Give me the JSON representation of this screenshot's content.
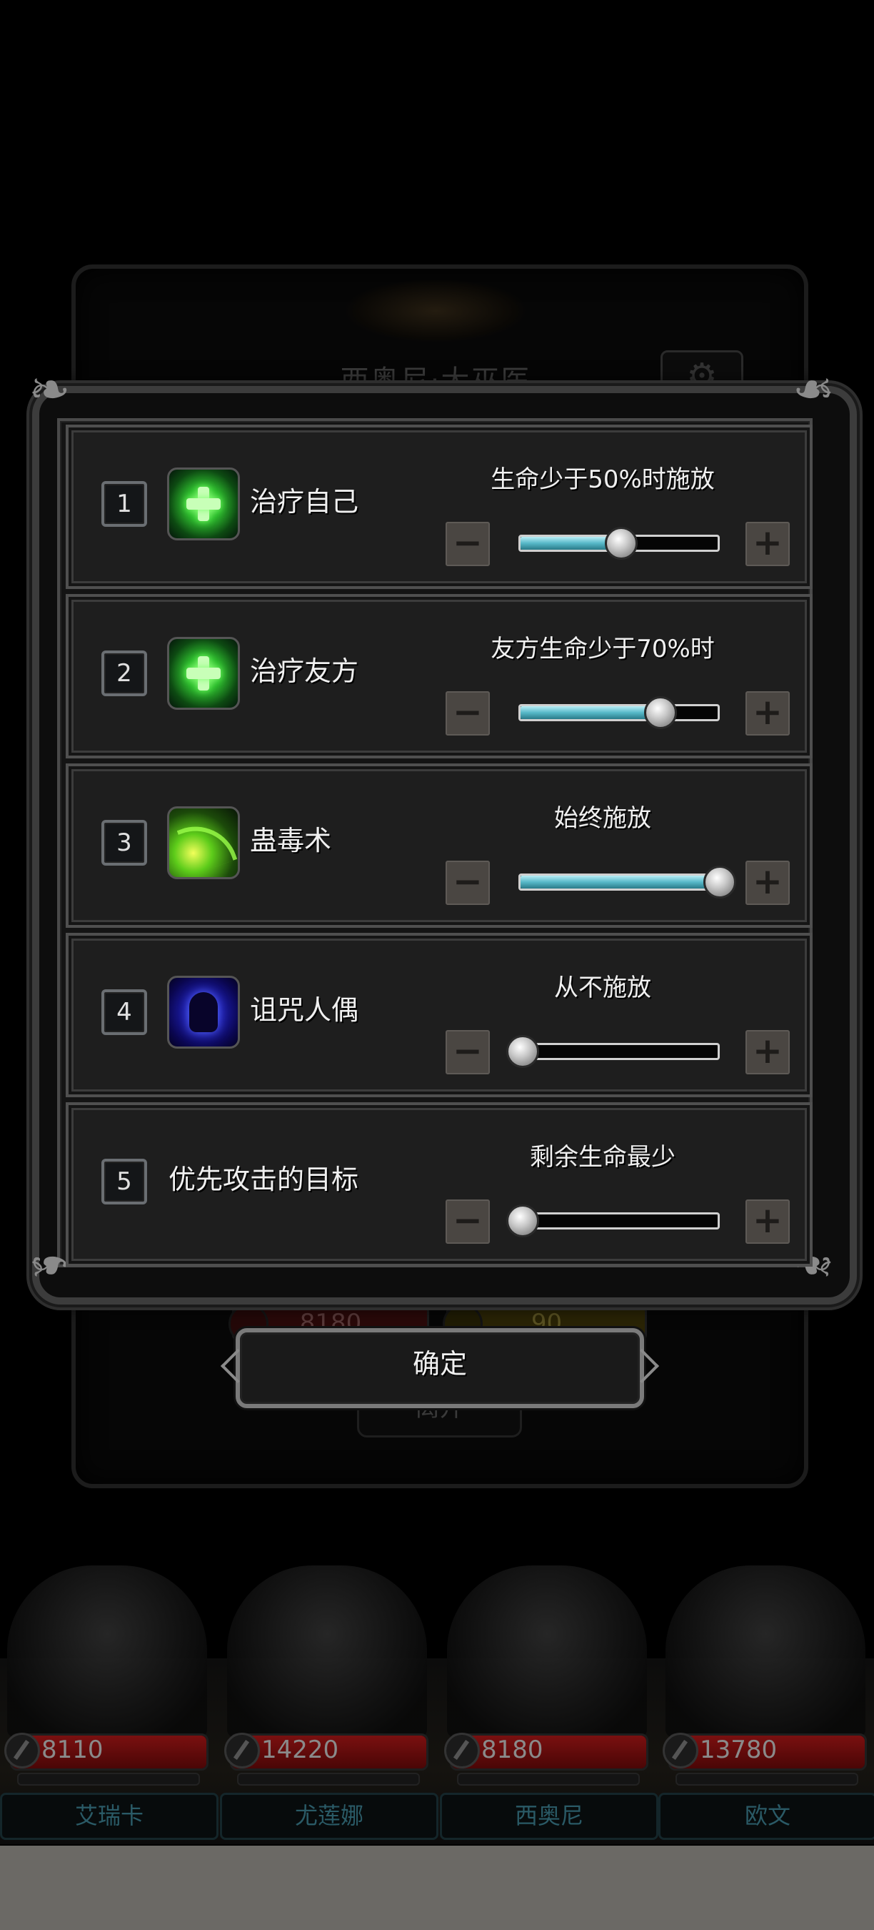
{
  "background": {
    "hero_title": "西奥尼·大巫医",
    "hp_value": "8180",
    "energy_value": "90",
    "leave_label": "离开"
  },
  "heroes": [
    {
      "name": "艾瑞卡",
      "hp": "8110"
    },
    {
      "name": "尤莲娜",
      "hp": "14220"
    },
    {
      "name": "西奥尼",
      "hp": "8180"
    },
    {
      "name": "欧文",
      "hp": "13780"
    }
  ],
  "settings": [
    {
      "index": "1",
      "icon": "heal-icon",
      "label": "治疗自己",
      "condition": "生命少于50%时施放",
      "level": 0.5
    },
    {
      "index": "2",
      "icon": "heal-icon",
      "label": "治疗友方",
      "condition": "友方生命少于70%时",
      "level": 0.7
    },
    {
      "index": "3",
      "icon": "poison-icon",
      "label": "蛊毒术",
      "condition": "始终施放",
      "level": 1.0
    },
    {
      "index": "4",
      "icon": "curse-doll-icon",
      "label": "诅咒人偶",
      "condition": "从不施放",
      "level": 0.0
    },
    {
      "index": "5",
      "icon": "",
      "label": "优先攻击的目标",
      "condition": "剩余生命最少",
      "level": 0.0
    }
  ],
  "buttons": {
    "minus": "−",
    "plus": "+",
    "confirm": "确定"
  },
  "colors": {
    "slider_fill": "#57b8c8",
    "hp_bar": "#7a1010"
  }
}
